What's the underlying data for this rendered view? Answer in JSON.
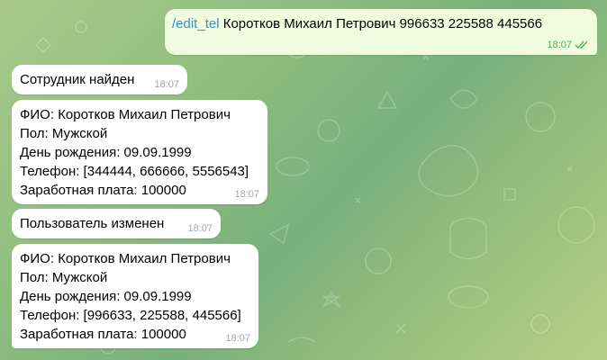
{
  "messages": [
    {
      "command": "/edit_tel",
      "text": " Коротков Михаил Петрович 996633 225588 445566",
      "time": "18:07"
    },
    {
      "text": "Сотрудник найден",
      "time": "18:07"
    },
    {
      "lines": [
        "ФИО: Коротков Михаил Петрович",
        "Пол: Мужской",
        "День рождения: 09.09.1999",
        "Телефон: [344444, 666666, 5556543]",
        "Заработная плата: 100000"
      ],
      "time": "18:07"
    },
    {
      "text": "Пользователь изменен",
      "time": "18:07"
    },
    {
      "lines": [
        "ФИО: Коротков Михаил Петрович",
        "Пол: Мужской",
        "День рождения: 09.09.1999",
        "Телефон: [996633, 225588, 445566]",
        "Заработная плата: 100000"
      ],
      "time": "18:07"
    }
  ],
  "colors": {
    "outgoing_bubble": "#effdde",
    "incoming_bubble": "#ffffff",
    "command_link": "#3a8fd0",
    "outgoing_meta": "#5fa863"
  },
  "icons": [
    "double-check-icon"
  ]
}
